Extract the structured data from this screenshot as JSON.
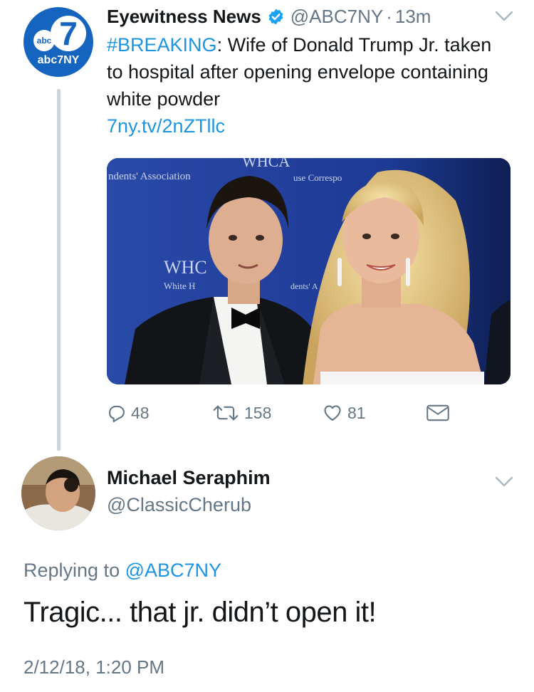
{
  "tweet": {
    "author": {
      "display_name": "Eyewitness News",
      "handle": "@ABC7NY",
      "verified": true,
      "avatar": {
        "logo_abc": "abc",
        "logo_seven": "7",
        "label": "abc7NY"
      }
    },
    "separator": "·",
    "time_ago": "13m",
    "text": {
      "hashtag": "#BREAKING",
      "body": ": Wife of Donald Trump Jr. taken to hospital after opening envelope containing white powder",
      "link": "7ny.tv/2nZTllc"
    },
    "media": {
      "backdrop_texts": [
        "ndents' Association",
        "WHCA",
        "use Correspo",
        "ciation",
        "WHC",
        "White H",
        "dents' A"
      ]
    },
    "actions": {
      "replies": "48",
      "retweets": "158",
      "likes": "81"
    }
  },
  "reply": {
    "author": {
      "display_name": "Michael Seraphim",
      "handle": "@ClassicCherub"
    },
    "replying_to_prefix": "Replying to ",
    "replying_to_handle": "@ABC7NY",
    "text": "Tragic... that jr. didn’t open it!",
    "date": "2/12/18, 1:20 PM"
  },
  "icons": {
    "verified": "verified-badge-icon",
    "caret": "chevron-down-icon",
    "reply": "reply-icon",
    "retweet": "retweet-icon",
    "like": "heart-icon",
    "dm": "envelope-icon"
  },
  "colors": {
    "link": "#1b95e0",
    "secondary_text": "#657786",
    "primary_text": "#14171a",
    "abc_blue": "#1565c0",
    "thread_line": "#ccd6dd"
  }
}
